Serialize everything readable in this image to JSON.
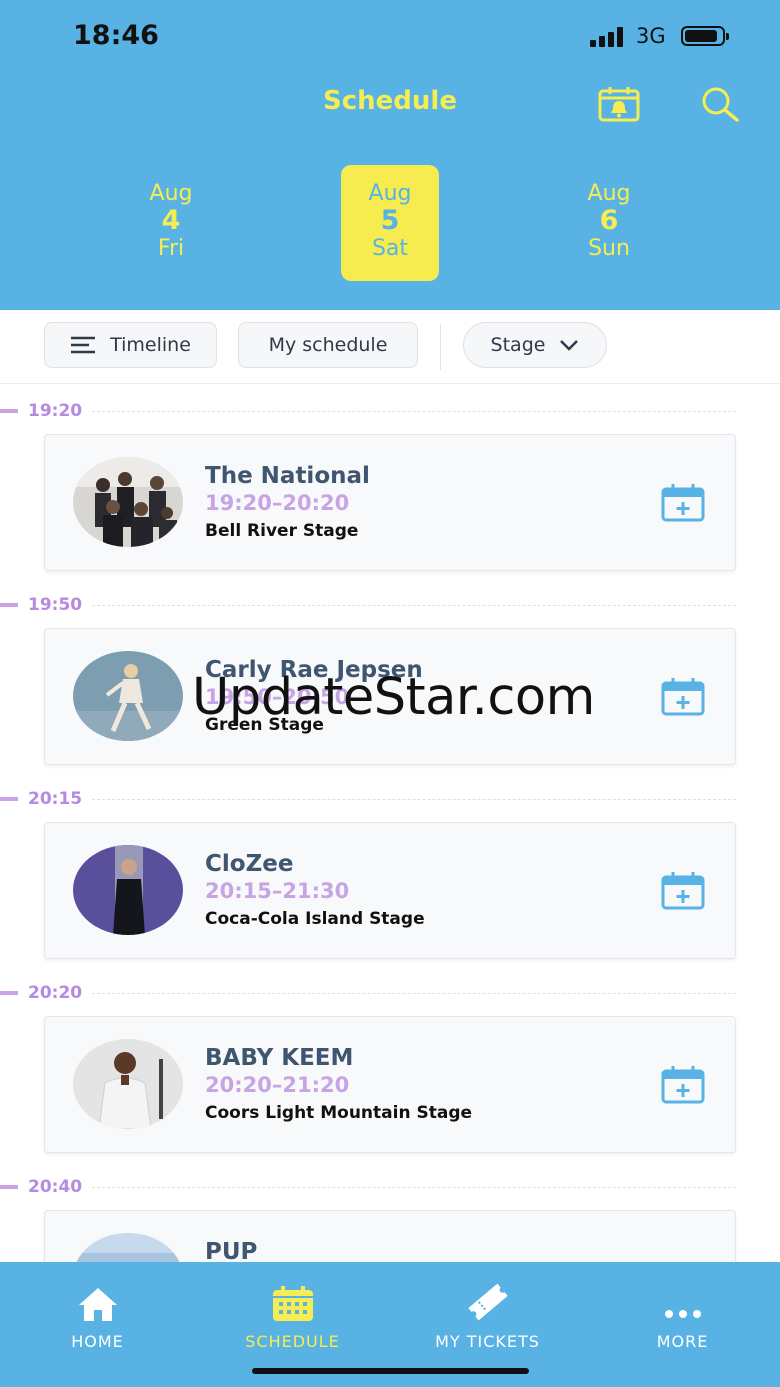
{
  "status_bar": {
    "time": "18:46",
    "network": "3G"
  },
  "header": {
    "title": "Schedule"
  },
  "dates": [
    {
      "month": "Aug",
      "day": "4",
      "weekday": "Fri",
      "selected": false
    },
    {
      "month": "Aug",
      "day": "5",
      "weekday": "Sat",
      "selected": true
    },
    {
      "month": "Aug",
      "day": "6",
      "weekday": "Sun",
      "selected": false
    }
  ],
  "filters": {
    "timeline": "Timeline",
    "my_schedule": "My schedule",
    "stage": "Stage"
  },
  "slots": [
    {
      "time": "19:20",
      "artist": "The National",
      "range": "19:20–20:20",
      "stage": "Bell River Stage"
    },
    {
      "time": "19:50",
      "artist": "Carly Rae Jepsen",
      "range": "19:50–20:50",
      "stage": "Green Stage"
    },
    {
      "time": "20:15",
      "artist": "CloZee",
      "range": "20:15–21:30",
      "stage": "Coca-Cola Island Stage"
    },
    {
      "time": "20:20",
      "artist": "BABY KEEM",
      "range": "20:20–21:20",
      "stage": "Coors Light Mountain Stage"
    },
    {
      "time": "20:40",
      "artist": "PUP",
      "range": "",
      "stage": ""
    }
  ],
  "watermark": "UpdateStar.com",
  "tabbar": {
    "home": "HOME",
    "schedule": "SCHEDULE",
    "tickets": "MY TICKETS",
    "more": "MORE"
  },
  "colors": {
    "header_bg": "#58b3e4",
    "accent_yellow": "#f5ed52",
    "time_purple": "#b58ae0",
    "artist_blue": "#3f5671"
  }
}
